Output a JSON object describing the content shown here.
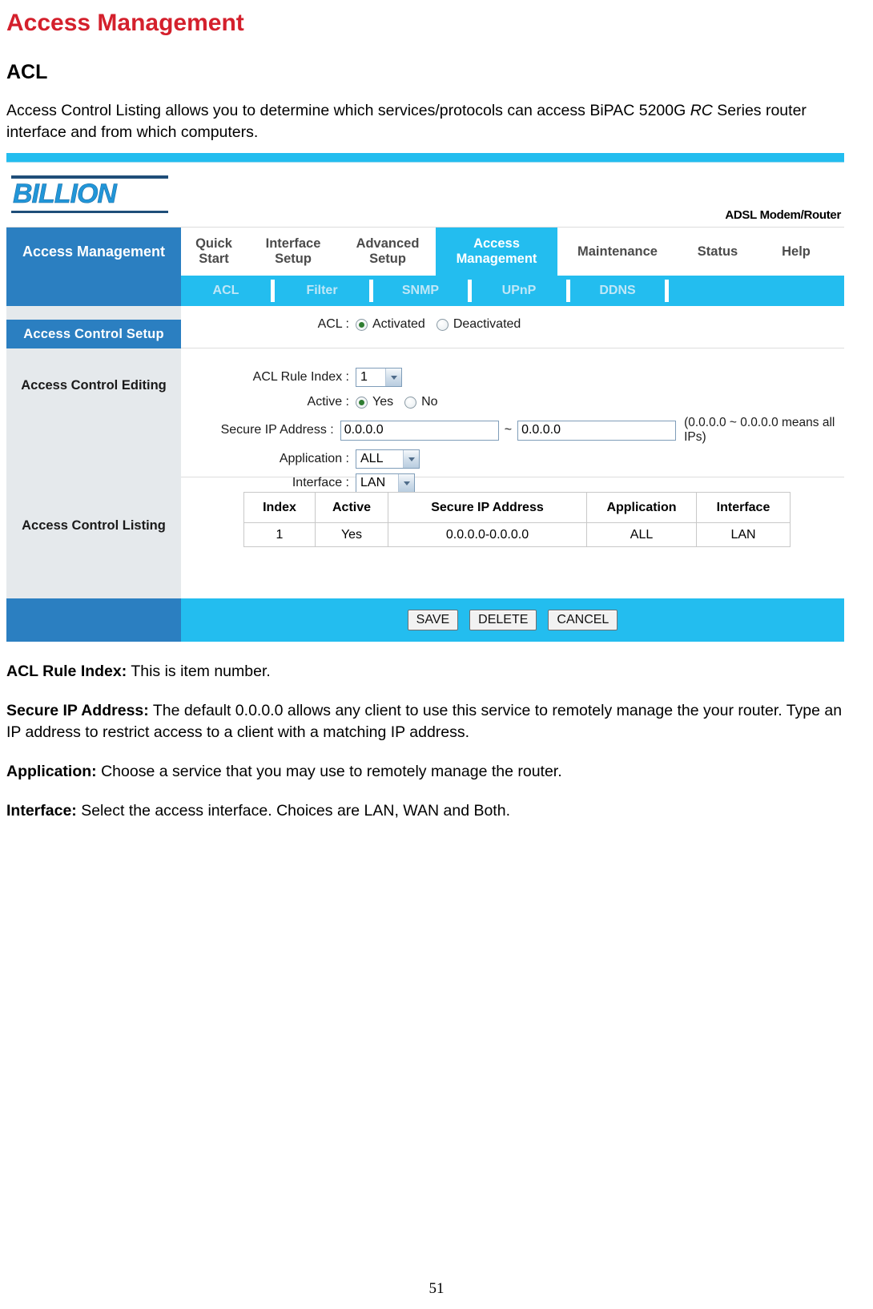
{
  "document": {
    "title": "Access Management",
    "section_heading": "ACL",
    "intro_part1": "Access Control Listing allows you to determine which services/protocols can access BiPAC 5200G ",
    "intro_italic": "RC",
    "intro_part2": " Series router interface and from which computers.",
    "page_number": "51"
  },
  "descriptions": [
    {
      "term": "ACL Rule Index:",
      "text": " This is item number."
    },
    {
      "term": "Secure IP Address:",
      "text": " The default 0.0.0.0 allows any client to use this service to remotely manage the your router. Type an IP address to restrict access to a client with a matching IP address."
    },
    {
      "term": "Application:",
      "text": " Choose a service that you may use to remotely manage the router."
    },
    {
      "term": "Interface:",
      "text": " Select the access interface. Choices are LAN, WAN and Both."
    }
  ],
  "router_ui": {
    "logo_text": "BILLION",
    "model_text": "ADSL Modem/Router",
    "brand_panel": "Access\nManagement",
    "nav": [
      {
        "label": "Quick\nStart",
        "active": false
      },
      {
        "label": "Interface\nSetup",
        "active": false
      },
      {
        "label": "Advanced\nSetup",
        "active": false
      },
      {
        "label": "Access\nManagement",
        "active": true
      },
      {
        "label": "Maintenance",
        "active": false
      },
      {
        "label": "Status",
        "active": false
      },
      {
        "label": "Help",
        "active": false
      }
    ],
    "subnav": [
      {
        "label": "ACL"
      },
      {
        "label": "Filter"
      },
      {
        "label": "SNMP"
      },
      {
        "label": "UPnP"
      },
      {
        "label": "DDNS"
      }
    ],
    "sidebar": {
      "header": "Access Control Setup",
      "label_editing": "Access Control Editing",
      "label_listing": "Access Control Listing"
    },
    "form": {
      "acl_label": "ACL :",
      "acl_option_activated": "Activated",
      "acl_option_deactivated": "Deactivated",
      "acl_selected": "Activated",
      "rule_index_label": "ACL Rule Index :",
      "rule_index_value": "1",
      "active_label": "Active :",
      "active_option_yes": "Yes",
      "active_option_no": "No",
      "active_selected": "Yes",
      "secure_ip_label": "Secure IP Address :",
      "secure_ip_start": "0.0.0.0",
      "secure_ip_tilde": "~",
      "secure_ip_end": "0.0.0.0",
      "secure_ip_hint": "(0.0.0.0 ~ 0.0.0.0 means all IPs)",
      "application_label": "Application :",
      "application_value": "ALL",
      "interface_label": "Interface :",
      "interface_value": "LAN"
    },
    "table": {
      "headers": [
        "Index",
        "Active",
        "Secure IP Address",
        "Application",
        "Interface"
      ],
      "rows": [
        [
          "1",
          "Yes",
          "0.0.0.0-0.0.0.0",
          "ALL",
          "LAN"
        ]
      ]
    },
    "buttons": {
      "save": "SAVE",
      "delete": "DELETE",
      "cancel": "CANCEL"
    },
    "colors": {
      "brand_blue": "#2b7fc1",
      "cyan": "#23bdef",
      "sidebar_grey": "#e5e9ec",
      "logo_blue": "#2196d8"
    }
  }
}
